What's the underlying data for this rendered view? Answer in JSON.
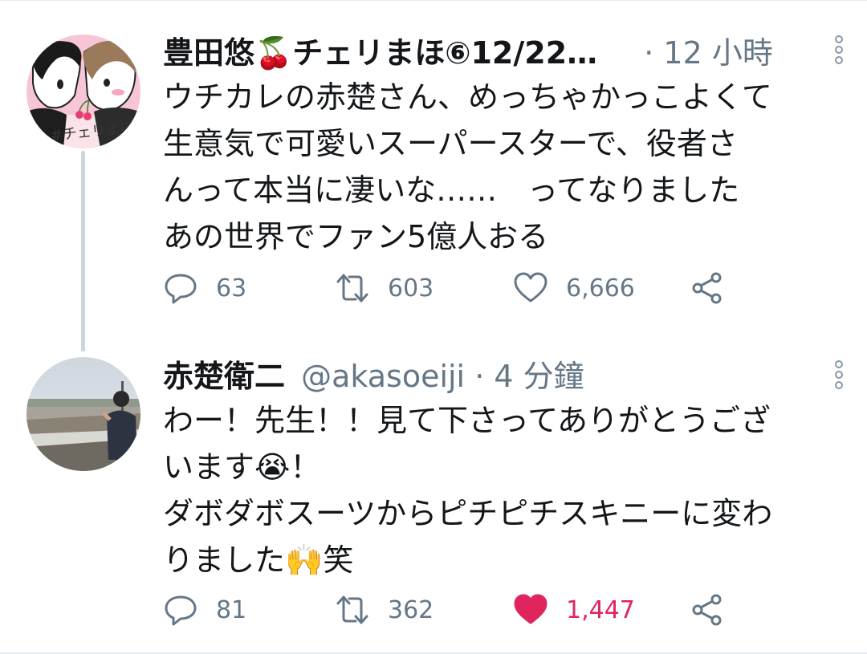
{
  "tweets": [
    {
      "display_name": "豊田悠🍒チェリまほ⑥12/22…",
      "handle": "",
      "separator": "·",
      "time": "12 小時",
      "avatar_caption": "#チェリまほ",
      "text_lines": [
        "ウチカレの赤楚さん、めっちゃかっこよくて",
        "生意気で可愛いスーパースターで、役者さ",
        "んって本当に凄いな……　ってなりました",
        "あの世界でファン5億人おる"
      ],
      "replies": "63",
      "retweets": "603",
      "likes": "6,666",
      "liked": false
    },
    {
      "display_name": "赤楚衛二",
      "handle": "@akasoeiji",
      "separator": "·",
      "time": "4 分鐘",
      "text_lines": [
        "わー！先生！！見て下さってありがとうござ",
        "います😭！",
        "ダボダボスーツからピチピチスキニーに変わ",
        "りました🙌笑"
      ],
      "replies": "81",
      "retweets": "362",
      "likes": "1,447",
      "liked": true
    }
  ],
  "icons": {
    "reply": "reply-icon",
    "retweet": "retweet-icon",
    "like": "heart-icon",
    "share": "share-icon",
    "more": "more-vertical-icon"
  },
  "colors": {
    "text": "#14171a",
    "secondary": "#657786",
    "like_active": "#e0245e",
    "thread_line": "#ccd6dd"
  }
}
